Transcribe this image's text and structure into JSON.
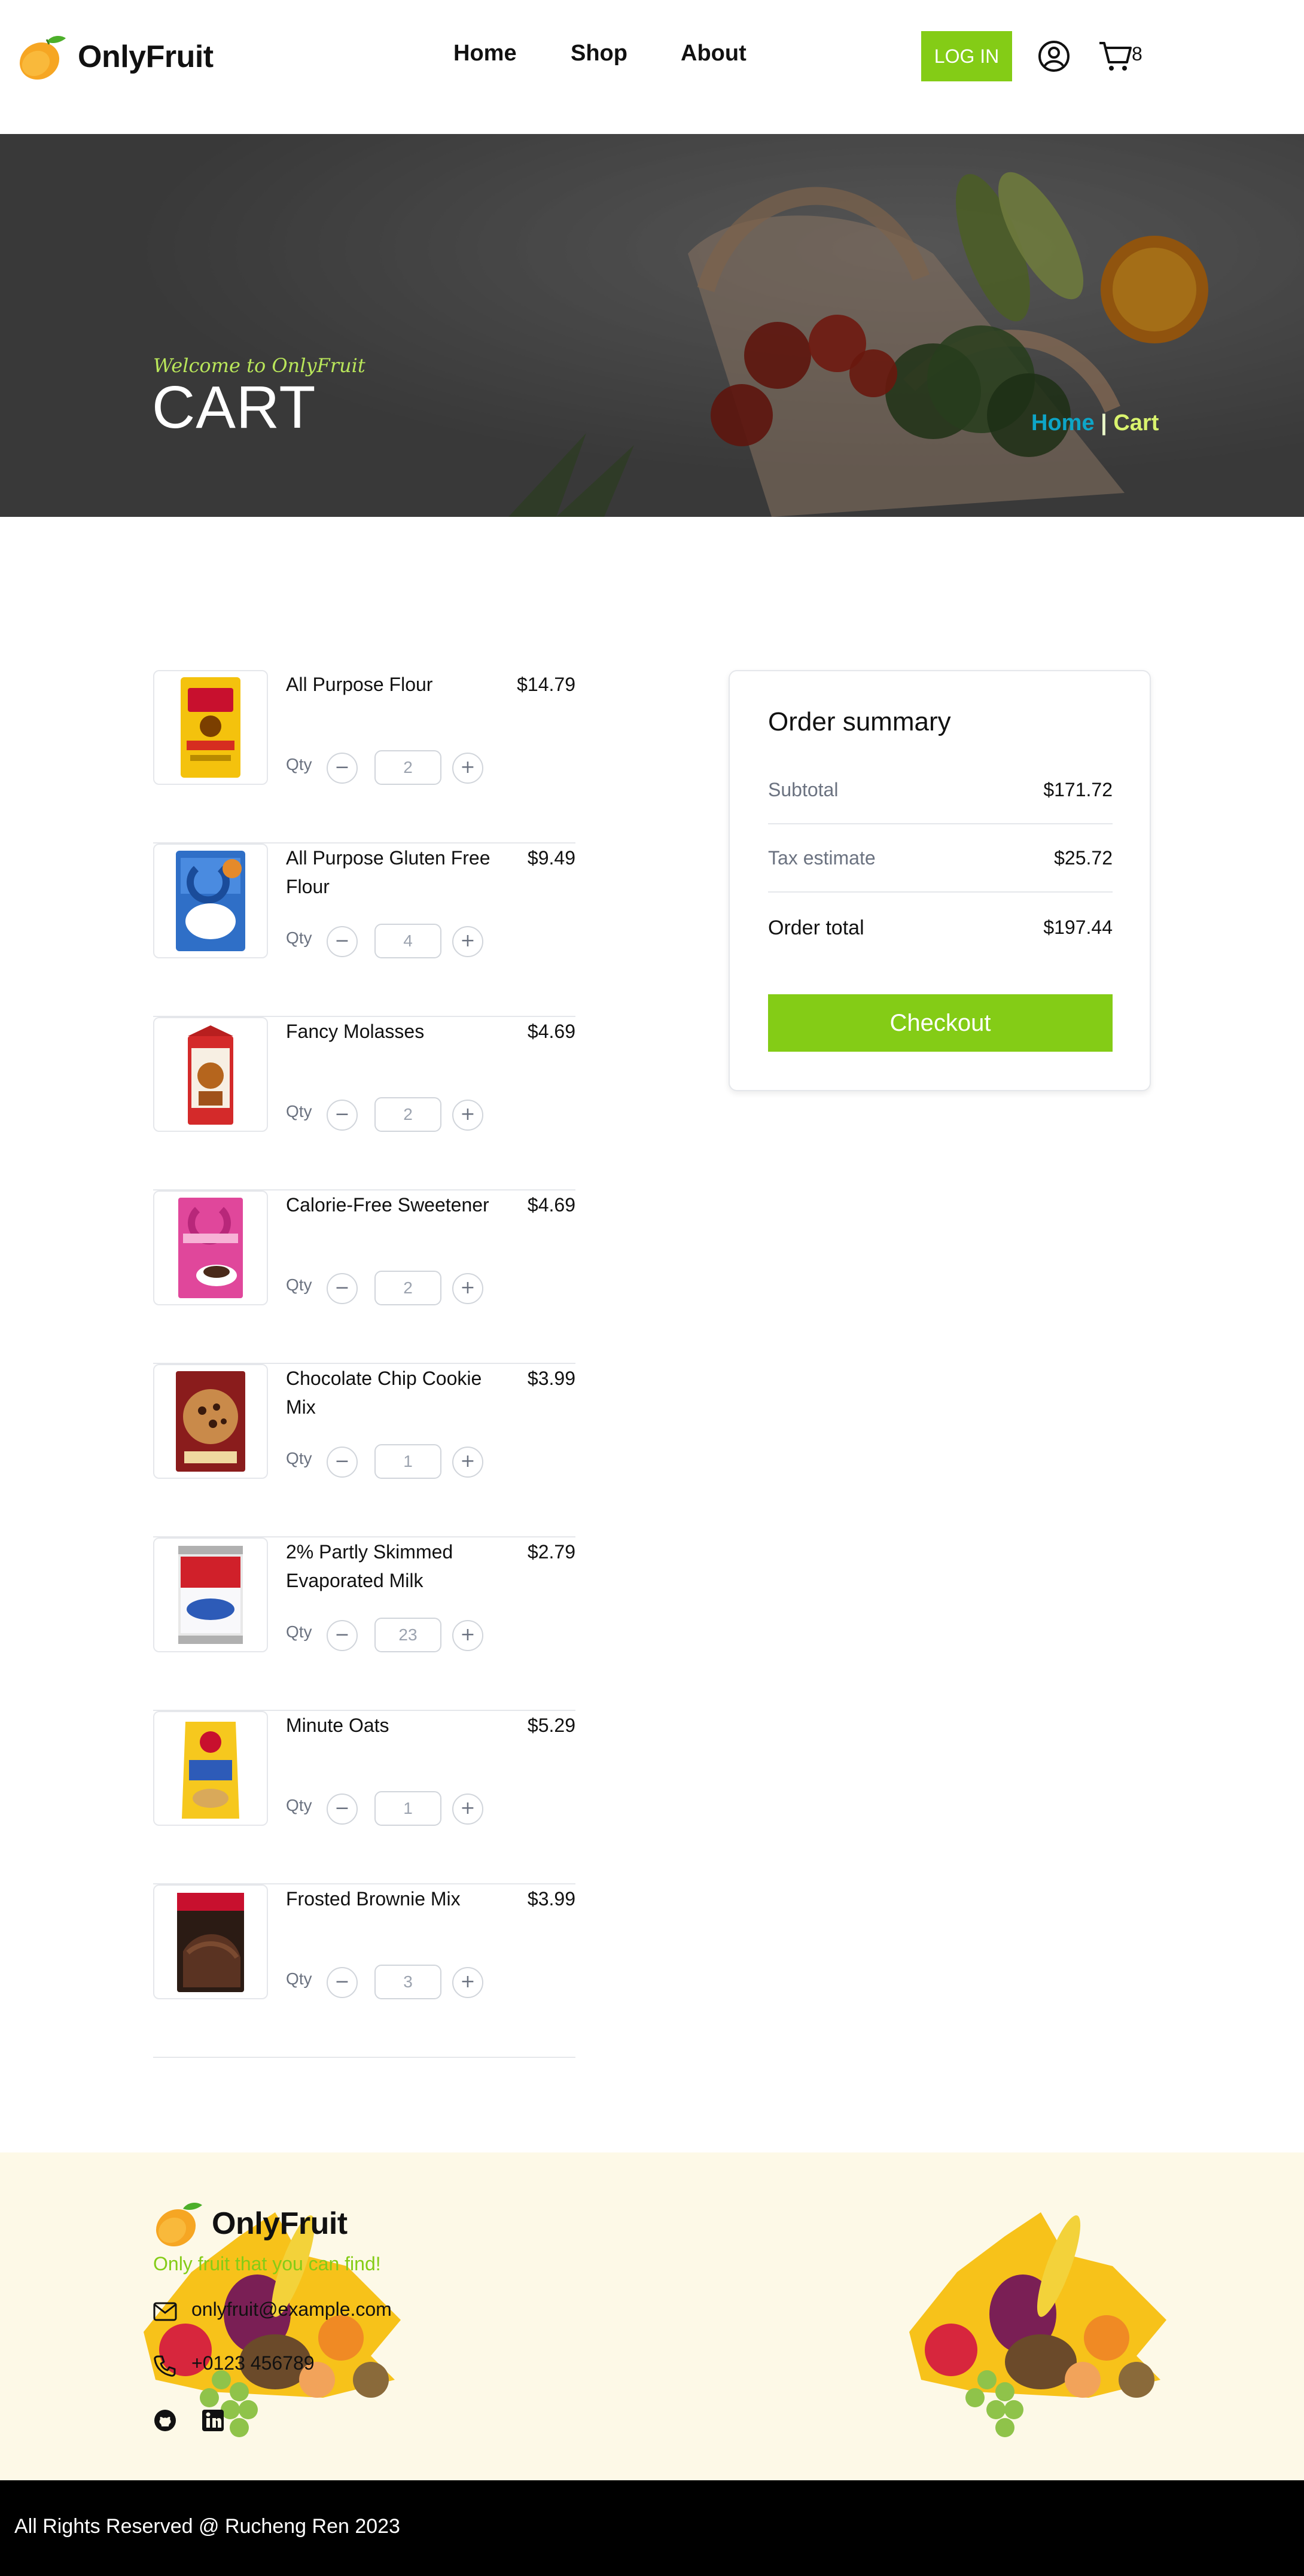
{
  "brand": {
    "name": "OnlyFruit",
    "accent": "#84cc16"
  },
  "nav": {
    "items": [
      "Home",
      "Shop",
      "About"
    ],
    "login_label": "LOG IN",
    "cart_count": "8",
    "icons": [
      "user-icon",
      "cart-icon"
    ]
  },
  "hero": {
    "welcome": "Welcome to OnlyFruit",
    "title": "CART",
    "breadcrumb": {
      "home": "Home",
      "separator": "|",
      "current": "Cart"
    }
  },
  "cart": {
    "qty_label": "Qty",
    "items": [
      {
        "name": "All Purpose Flour",
        "price": "$14.79",
        "qty": "2"
      },
      {
        "name": "All Purpose Gluten Free Flour",
        "price": "$9.49",
        "qty": "4"
      },
      {
        "name": "Fancy Molasses",
        "price": "$4.69",
        "qty": "2"
      },
      {
        "name": "Calorie-Free Sweetener",
        "price": "$4.69",
        "qty": "2"
      },
      {
        "name": "Chocolate Chip Cookie Mix",
        "price": "$3.99",
        "qty": "1"
      },
      {
        "name": "2% Partly Skimmed Evaporated Milk",
        "price": "$2.79",
        "qty": "23"
      },
      {
        "name": "Minute Oats",
        "price": "$5.29",
        "qty": "1"
      },
      {
        "name": "Frosted Brownie Mix",
        "price": "$3.99",
        "qty": "3"
      }
    ]
  },
  "summary": {
    "title": "Order summary",
    "subtotal_label": "Subtotal",
    "subtotal": "$171.72",
    "tax_label": "Tax estimate",
    "tax": "$25.72",
    "total_label": "Order total",
    "total": "$197.44",
    "checkout_label": "Checkout"
  },
  "footer": {
    "brand": "OnlyFruit",
    "tagline": "Only fruit that you can find!",
    "email": "onlyfruit@example.com",
    "phone": "+0123 456789",
    "social_icons": [
      "github-icon",
      "linkedin-icon"
    ],
    "copyright": "All Rights Reserved @ Rucheng Ren 2023"
  }
}
